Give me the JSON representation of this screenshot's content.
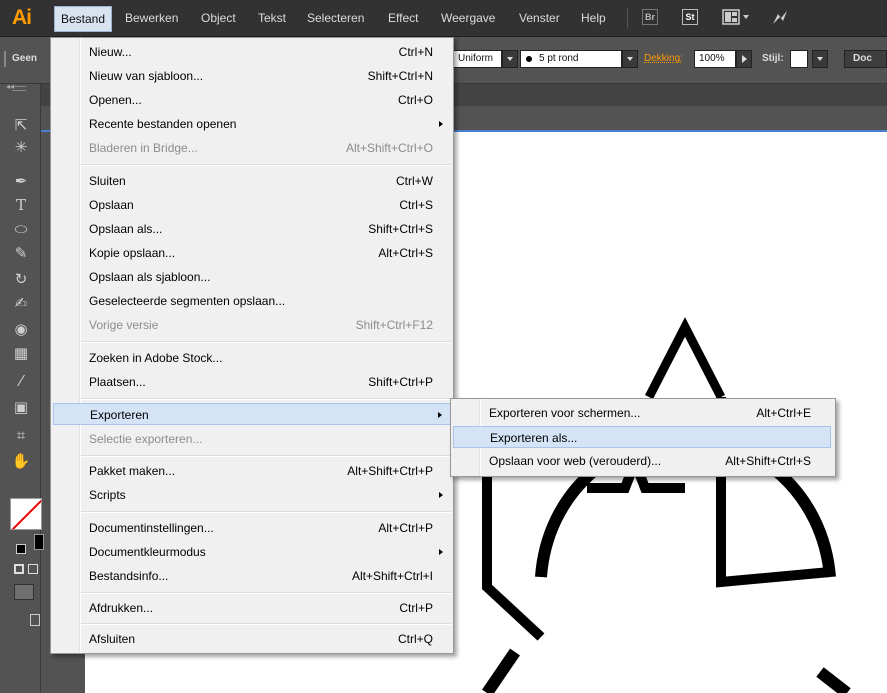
{
  "app": {
    "logo": "Ai",
    "accent_color": "#ff9a00"
  },
  "menubar": {
    "items": [
      "Bestand",
      "Bewerken",
      "Object",
      "Tekst",
      "Selecteren",
      "Effect",
      "Weergave",
      "Venster",
      "Help"
    ],
    "bridge_label": "Br",
    "stock_label": "St"
  },
  "controlbar": {
    "left_label": "Geen",
    "profile_value": "Uniform",
    "brush_value": "5 pt rond",
    "opacity_label": "Dekking:",
    "opacity_value": "100%",
    "style_label": "Stijl:",
    "doc_label": "Doc"
  },
  "file_menu": {
    "items": [
      {
        "label": "Nieuw...",
        "shortcut": "Ctrl+N"
      },
      {
        "label": "Nieuw van sjabloon...",
        "shortcut": "Shift+Ctrl+N"
      },
      {
        "label": "Openen...",
        "shortcut": "Ctrl+O"
      },
      {
        "label": "Recente bestanden openen",
        "shortcut": ""
      },
      {
        "label": "Bladeren in Bridge...",
        "shortcut": "Alt+Shift+Ctrl+O"
      },
      {
        "label": "Sluiten",
        "shortcut": "Ctrl+W"
      },
      {
        "label": "Opslaan",
        "shortcut": "Ctrl+S"
      },
      {
        "label": "Opslaan als...",
        "shortcut": "Shift+Ctrl+S"
      },
      {
        "label": "Kopie opslaan...",
        "shortcut": "Alt+Ctrl+S"
      },
      {
        "label": "Opslaan als sjabloon...",
        "shortcut": ""
      },
      {
        "label": "Geselecteerde segmenten opslaan...",
        "shortcut": ""
      },
      {
        "label": "Vorige versie",
        "shortcut": "Shift+Ctrl+F12"
      },
      {
        "label": "Zoeken in Adobe Stock...",
        "shortcut": ""
      },
      {
        "label": "Plaatsen...",
        "shortcut": "Shift+Ctrl+P"
      },
      {
        "label": "Exporteren",
        "shortcut": ""
      },
      {
        "label": "Selectie exporteren...",
        "shortcut": ""
      },
      {
        "label": "Pakket maken...",
        "shortcut": "Alt+Shift+Ctrl+P"
      },
      {
        "label": "Scripts",
        "shortcut": ""
      },
      {
        "label": "Documentinstellingen...",
        "shortcut": "Alt+Ctrl+P"
      },
      {
        "label": "Documentkleurmodus",
        "shortcut": ""
      },
      {
        "label": "Bestandsinfo...",
        "shortcut": "Alt+Shift+Ctrl+I"
      },
      {
        "label": "Afdrukken...",
        "shortcut": "Ctrl+P"
      },
      {
        "label": "Afsluiten",
        "shortcut": "Ctrl+Q"
      }
    ]
  },
  "export_submenu": {
    "items": [
      {
        "label": "Exporteren voor schermen...",
        "shortcut": "Alt+Ctrl+E"
      },
      {
        "label": "Exporteren als...",
        "shortcut": ""
      },
      {
        "label": "Opslaan voor web (verouderd)...",
        "shortcut": "Alt+Shift+Ctrl+S"
      }
    ]
  },
  "toolbar": {
    "icons": [
      "selection-icon",
      "magic-wand-icon",
      "pen-icon",
      "type-icon",
      "ellipse-icon",
      "pencil-icon",
      "rotate-icon",
      "width-icon",
      "shape-builder-icon",
      "perspective-grid-icon",
      "eyedropper-icon",
      "symbol-sprayer-icon",
      "artboard-icon",
      "hand-icon"
    ]
  }
}
